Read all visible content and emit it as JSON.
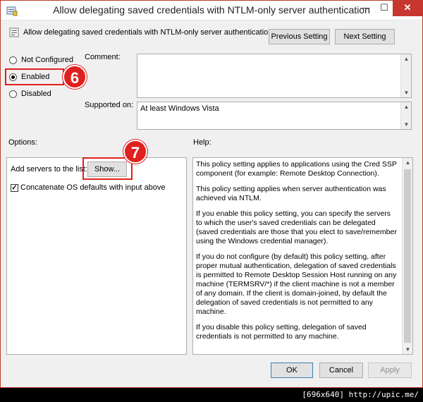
{
  "window": {
    "title": "Allow delegating saved credentials with NTLM-only server authentication",
    "minimize_glyph": "—",
    "maximize_glyph": "☐",
    "close_glyph": "✕"
  },
  "header": {
    "policy_name": "Allow delegating saved credentials with NTLM-only server authentication",
    "previous_label": "Previous Setting",
    "next_label": "Next Setting"
  },
  "state": {
    "options": [
      {
        "label": "Not Configured",
        "checked": false
      },
      {
        "label": "Enabled",
        "checked": true
      },
      {
        "label": "Disabled",
        "checked": false
      }
    ]
  },
  "comment": {
    "label": "Comment:",
    "value": ""
  },
  "supported": {
    "label": "Supported on:",
    "value": "At least Windows Vista"
  },
  "options_pane": {
    "heading": "Options:",
    "add_servers_label": "Add servers to the list:",
    "show_label": "Show...",
    "concatenate_label": "Concatenate OS defaults with input above",
    "concatenate_checked": true
  },
  "help_pane": {
    "heading": "Help:",
    "paragraphs": [
      "This policy setting applies to applications using the Cred SSP component (for example: Remote Desktop Connection).",
      "This policy setting applies when server authentication was achieved via NTLM.",
      "If you enable this policy setting, you can specify the servers to which the user's saved credentials can be delegated (saved credentials are those that you elect to save/remember using the Windows credential manager).",
      "If you do not configure (by default) this policy setting, after proper mutual authentication, delegation of saved credentials is permitted to Remote Desktop Session Host running on any machine (TERMSRV/*) if the client machine is not a member of any domain. If the client is domain-joined, by default the delegation of saved credentials is not permitted to any machine.",
      "If you disable this policy setting, delegation of saved credentials is not permitted to any machine."
    ]
  },
  "footer": {
    "ok_label": "OK",
    "cancel_label": "Cancel",
    "apply_label": "Apply"
  },
  "annotations": {
    "callout_6": "6",
    "callout_7": "7",
    "highlight_color": "#e0201e"
  },
  "watermark": "[696x640] http://upic.me/"
}
